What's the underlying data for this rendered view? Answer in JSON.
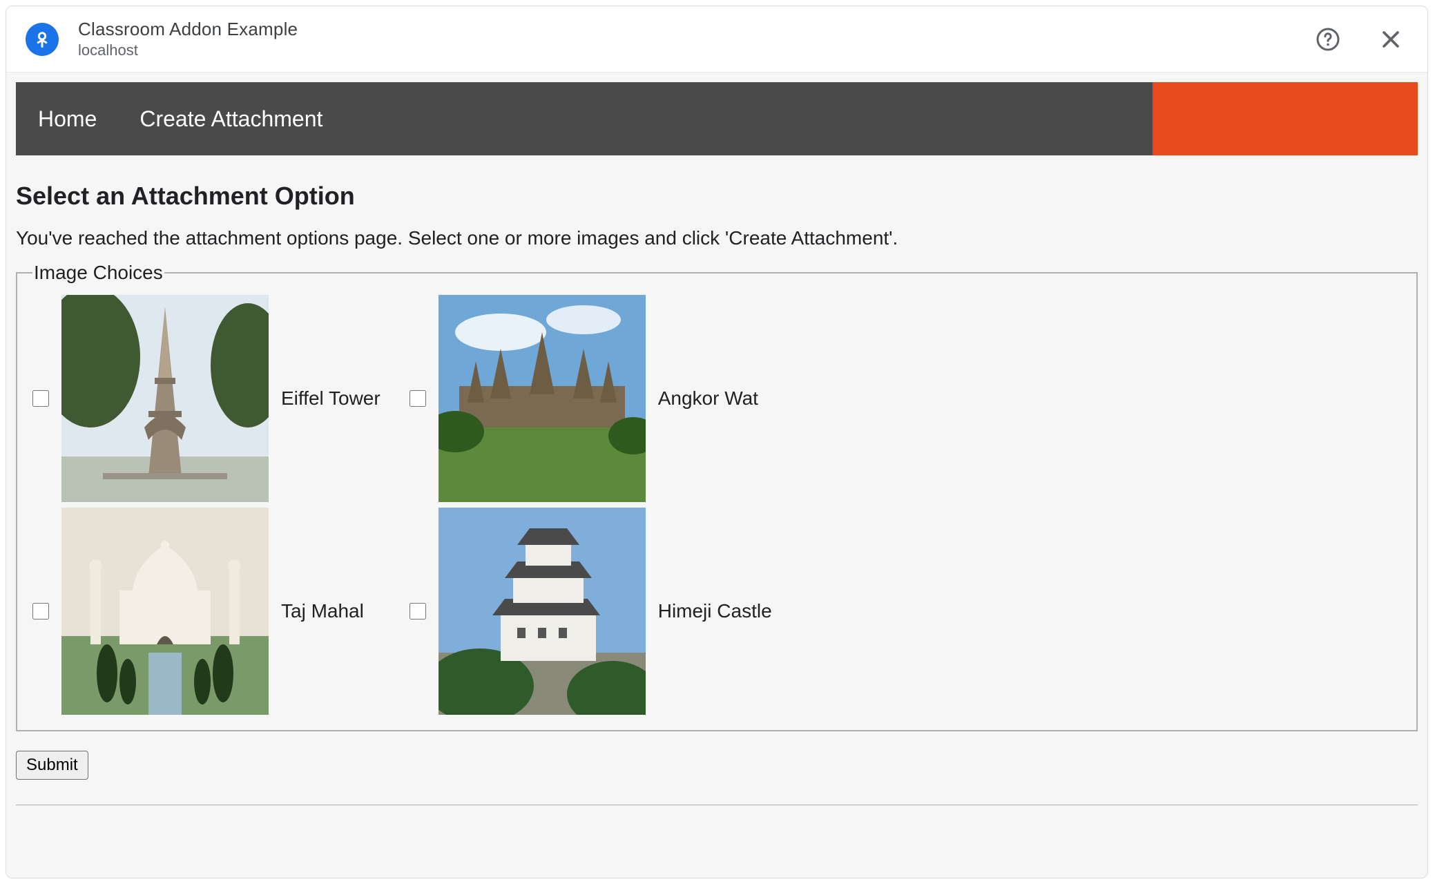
{
  "dialog": {
    "title": "Classroom Addon Example",
    "subtitle": "localhost"
  },
  "nav": {
    "home": "Home",
    "create": "Create Attachment"
  },
  "page": {
    "heading": "Select an Attachment Option",
    "description": "You've reached the attachment options page. Select one or more images and click 'Create Attachment'."
  },
  "fieldset": {
    "legend": "Image Choices",
    "items": [
      {
        "label": "Eiffel Tower"
      },
      {
        "label": "Angkor Wat"
      },
      {
        "label": "Taj Mahal"
      },
      {
        "label": "Himeji Castle"
      }
    ]
  },
  "submit_label": "Submit"
}
